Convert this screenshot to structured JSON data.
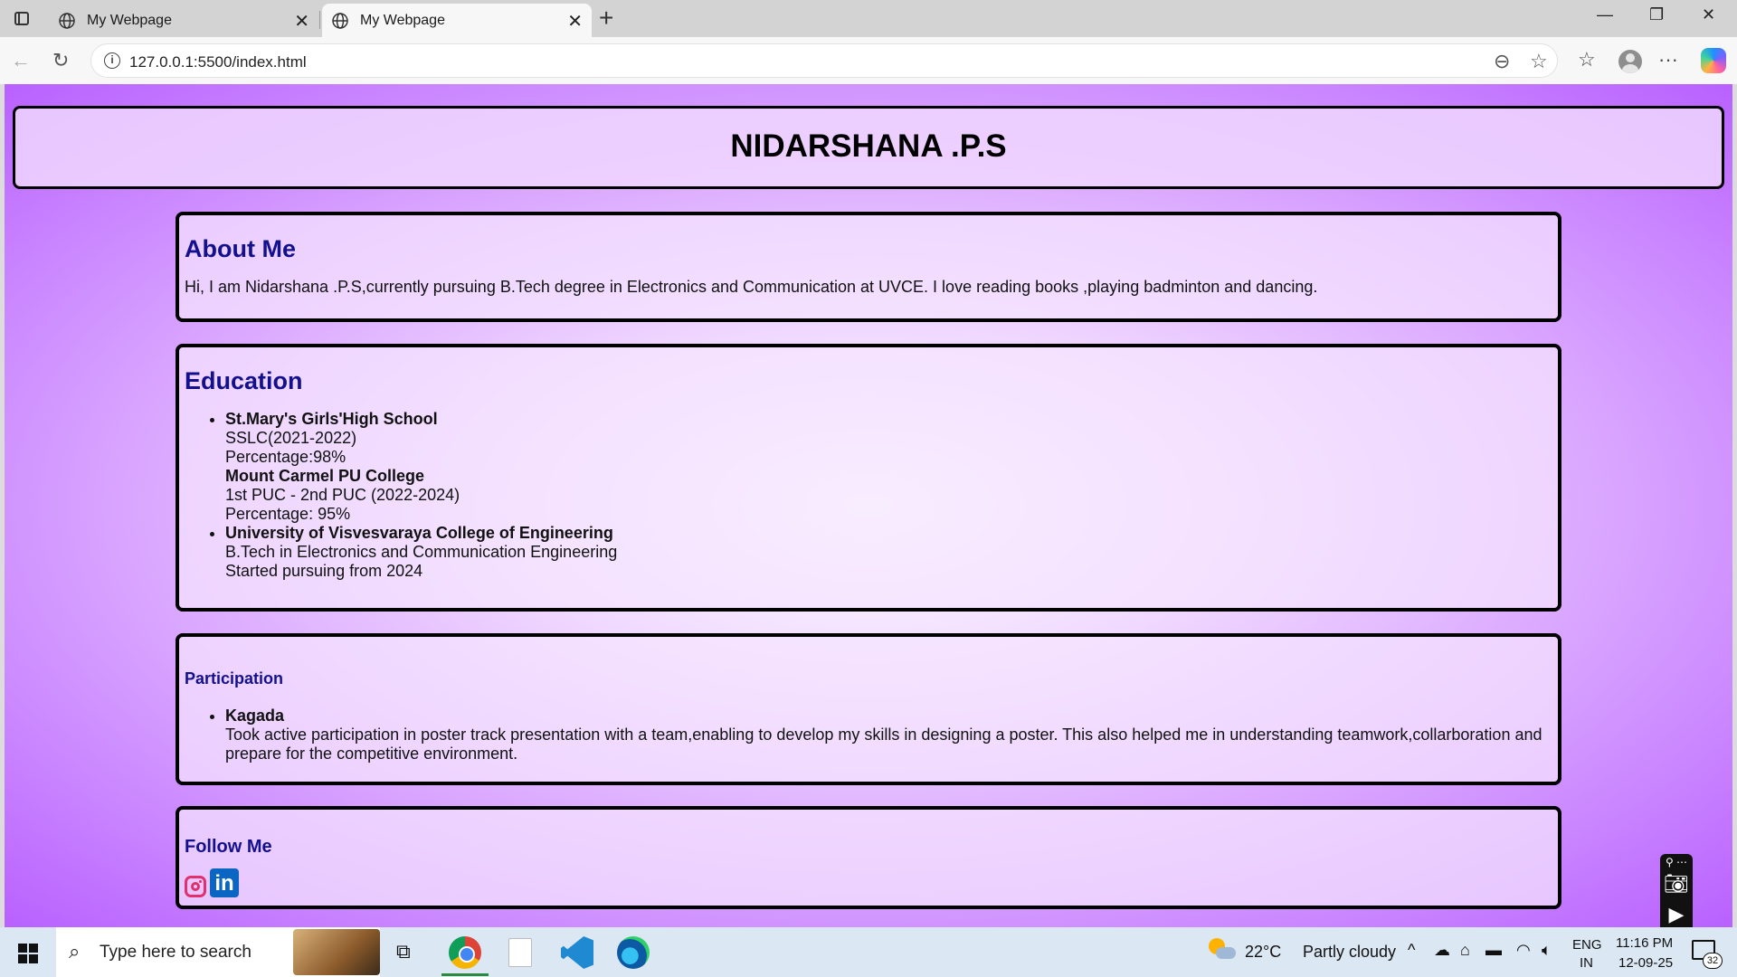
{
  "browser": {
    "tabs": [
      {
        "title": "My Webpage"
      },
      {
        "title": "My Webpage"
      }
    ],
    "url": "127.0.0.1:5500/index.html"
  },
  "page": {
    "header_title": "NIDARSHANA .P.S",
    "about": {
      "heading": "About Me",
      "text": "Hi, I am Nidarshana .P.S,currently pursuing B.Tech degree in Electronics and Communication at UVCE. I love reading books ,playing badminton and dancing."
    },
    "education": {
      "heading": "Education",
      "items": [
        {
          "lines": [
            {
              "text": "St.Mary's Girls'High School",
              "bold": true
            },
            {
              "text": "SSLC(2021-2022)",
              "bold": false
            },
            {
              "text": "Percentage:98%",
              "bold": false
            },
            {
              "text": "Mount Carmel PU College",
              "bold": true
            },
            {
              "text": "1st PUC - 2nd PUC (2022-2024)",
              "bold": false
            },
            {
              "text": "Percentage: 95%",
              "bold": false
            }
          ]
        },
        {
          "lines": [
            {
              "text": "University of Visvesvaraya College of Engineering",
              "bold": true
            },
            {
              "text": "B.Tech in Electronics and Communication Engineering",
              "bold": false
            },
            {
              "text": "Started pursuing from 2024",
              "bold": false
            }
          ]
        }
      ]
    },
    "participation": {
      "heading": "Participation",
      "items": [
        {
          "title": "Kagada",
          "text": "Took active participation in poster track presentation with a team,enabling to develop my skills in designing a poster. This also helped me in understanding teamwork,collarboration and prepare for the competitive environment."
        }
      ]
    },
    "follow": {
      "heading": "Follow Me",
      "links": [
        {
          "name": "instagram-icon"
        },
        {
          "name": "linkedin-icon",
          "glyph": "in"
        }
      ]
    }
  },
  "taskbar": {
    "search_placeholder": "Type here to search",
    "weather_temp": "22°C",
    "weather_desc": "Partly cloudy",
    "lang_top": "ENG",
    "lang_bottom": "IN",
    "time": "11:16 PM",
    "date": "12-09-25",
    "notification_count": "32"
  },
  "colors": {
    "heading": "#13108e",
    "page_gradient_edge": "#b861ff"
  }
}
